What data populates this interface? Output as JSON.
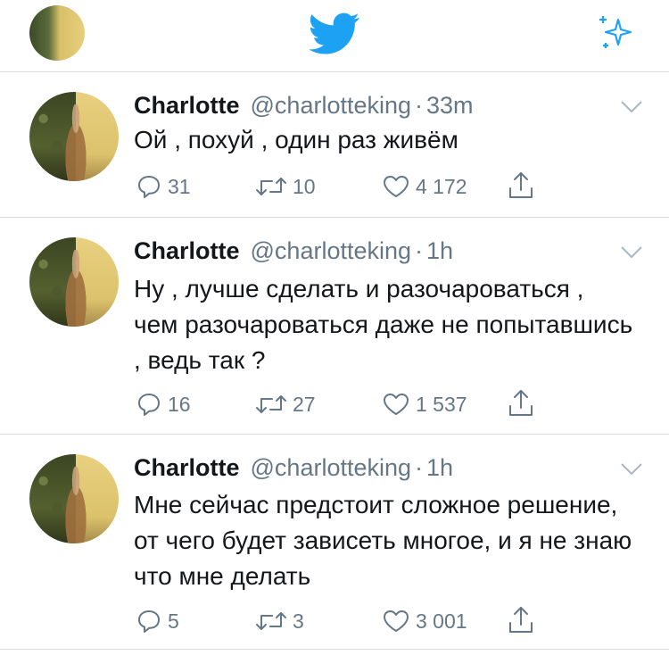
{
  "header": {
    "avatar": "profile-avatar",
    "logo": "twitter-bird-icon",
    "sparkle": "sparkle-icon",
    "accent_color": "#1da1f2"
  },
  "tweets": [
    {
      "name": "Charlotte",
      "handle": "@charlotteking",
      "separator": "·",
      "time": "33m",
      "text": "Ой , похуй , один раз живём",
      "replies": "31",
      "retweets": "10",
      "likes": "4 172"
    },
    {
      "name": "Charlotte",
      "handle": "@charlotteking",
      "separator": "·",
      "time": "1h",
      "text": "Ну , лучше сделать и разочароваться , чем разочароваться даже не попытавшись , ведь так ?",
      "replies": "16",
      "retweets": "27",
      "likes": "1 537"
    },
    {
      "name": "Charlotte",
      "handle": "@charlotteking",
      "separator": "·",
      "time": "1h",
      "text": "Мне сейчас предстоит сложное решение, от чего будет зависеть многое, и я не знаю что мне делать",
      "replies": "5",
      "retweets": "3",
      "likes": "3 001"
    }
  ]
}
